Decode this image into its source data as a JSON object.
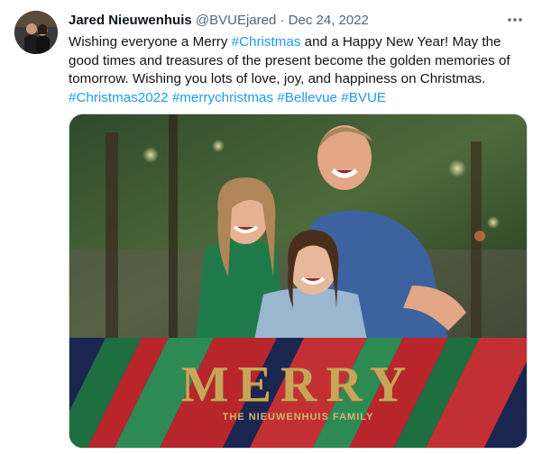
{
  "tweet": {
    "display_name": "Jared Nieuwenhuis",
    "handle": "@BVUEjared",
    "separator": "·",
    "date": "Dec 24, 2022",
    "more_icon": "more-horizontal-icon",
    "text_parts": {
      "p1": "Wishing everyone a Merry ",
      "tag1": "#Christmas",
      "p2": " and a Happy New Year! May the good times and treasures of the present become the golden memories of tomorrow. Wishing you lots of love, joy, and happiness on Christmas.",
      "tag2": "#Christmas2022",
      "tag3": "#merrychristmas",
      "tag4": "#Bellevue",
      "tag5": "#BVUE"
    },
    "image": {
      "headline": "MERRY",
      "subline": "THE NIEUWENHUIS FAMILY"
    },
    "colors": {
      "hashtag": "#1d9bf0",
      "gold": "#c9a55a",
      "stripe_red": "#b8252b",
      "stripe_green": "#1f6e3f",
      "stripe_navy": "#1a2550"
    }
  }
}
